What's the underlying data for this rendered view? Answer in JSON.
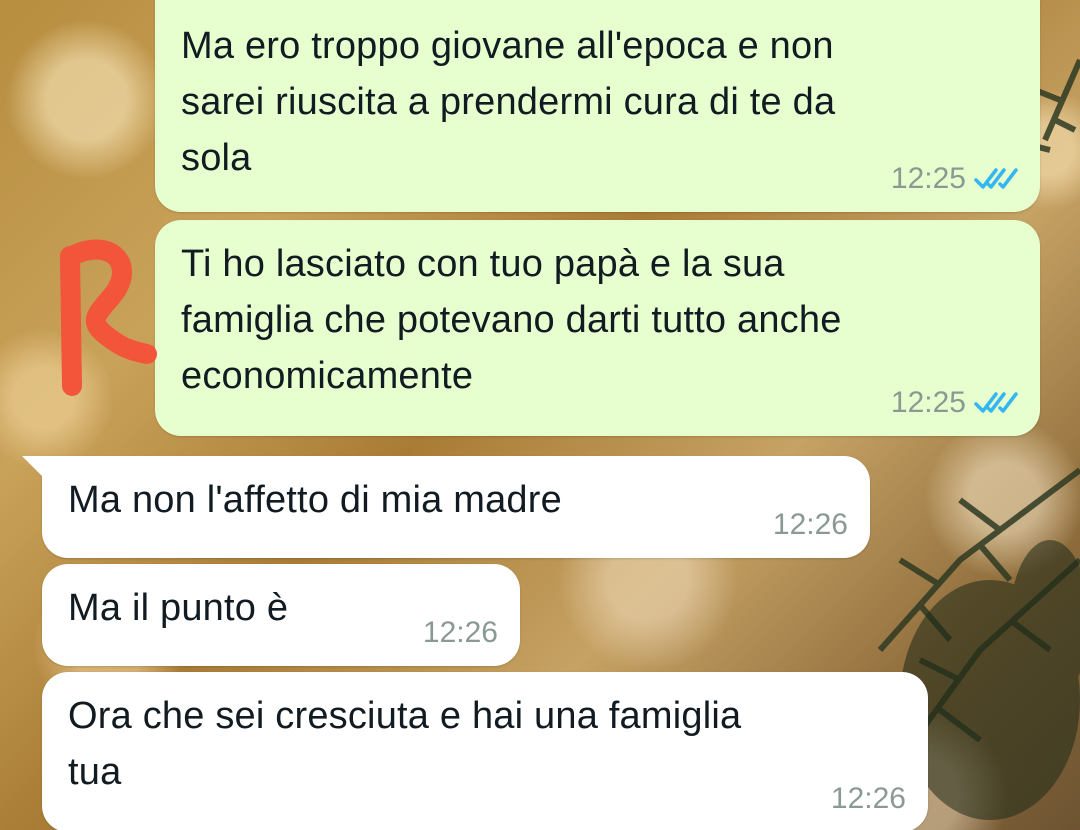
{
  "messages": [
    {
      "direction": "outgoing",
      "text": "Ma ero troppo giovane all'epoca e non\nsarei riuscita a prendermi cura di te da\nsola",
      "time": "12:25",
      "status": "read",
      "status_icon": "double-check-icon"
    },
    {
      "direction": "outgoing",
      "text": "Ti ho lasciato con tuo papà e la sua\nfamiglia che potevano darti tutto anche\neconomicamente",
      "time": "12:25",
      "status": "read",
      "status_icon": "double-check-icon"
    },
    {
      "direction": "incoming",
      "text": "Ma non l'affetto di mia madre",
      "time": "12:26"
    },
    {
      "direction": "incoming",
      "text": "Ma il punto è",
      "time": "12:26"
    },
    {
      "direction": "incoming",
      "text": "Ora che sei cresciuta e hai una famiglia\ntua",
      "time": "12:26"
    }
  ],
  "colors": {
    "outgoing_bubble": "#e7fecf",
    "incoming_bubble": "#ffffff",
    "read_ticks": "#34b7f1",
    "annotation": "#f2553a"
  },
  "annotation": {
    "type": "handwritten-red-mark",
    "icon": "red-scribble-mark"
  }
}
